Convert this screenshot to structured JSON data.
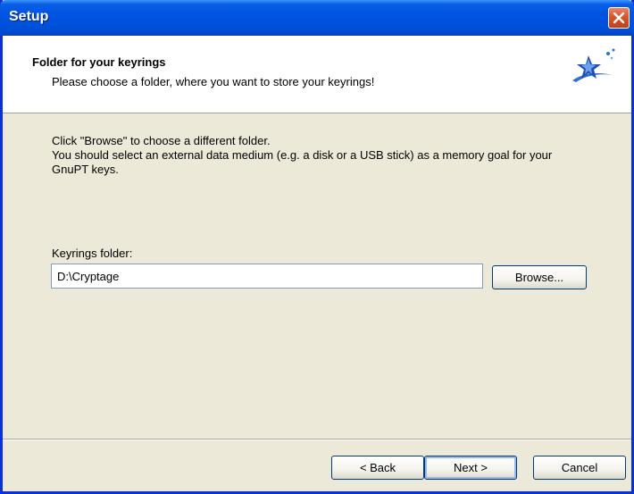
{
  "window": {
    "title": "Setup"
  },
  "header": {
    "title": "Folder for your keyrings",
    "subtitle": "Please choose a folder, where you want to store your keyrings!",
    "logo_icon": "star-swoosh-icon"
  },
  "body": {
    "description_line1": "Click \"Browse\" to choose a different folder.",
    "description_line2": "You should select an external data medium (e.g. a disk or a USB stick) as a memory goal for your GnuPT keys.",
    "folder_label": "Keyrings folder:",
    "folder_value": "D:\\Cryptage",
    "browse_label": "Browse..."
  },
  "footer": {
    "back_label": "< Back",
    "next_label": "Next >",
    "cancel_label": "Cancel"
  },
  "colors": {
    "titlebar": "#0054e3",
    "close_button": "#d9532c",
    "dialog_bg": "#ece9d8",
    "input_border": "#7f9db9"
  }
}
